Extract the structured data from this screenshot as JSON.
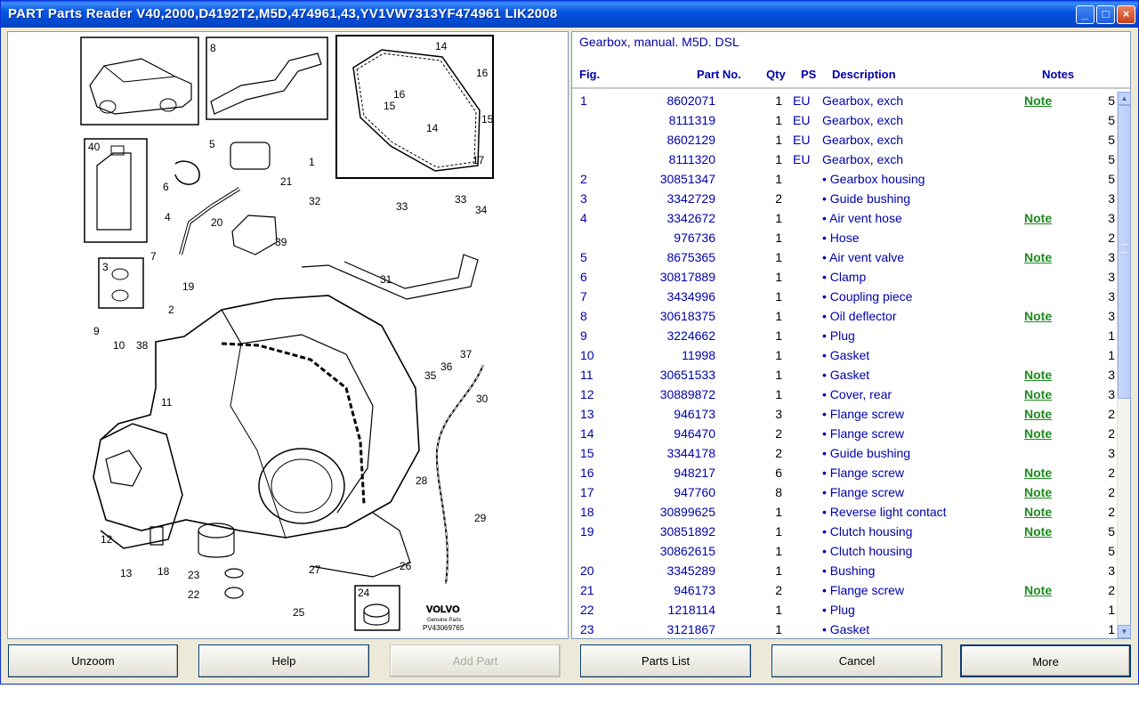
{
  "window": {
    "title": "PART Parts Reader V40,2000,D4192T2,M5D,474961,43,YV1VW7313YF474961 LIK2008",
    "min_glyph": "_",
    "max_glyph": "□",
    "close_glyph": "×"
  },
  "diagram": {
    "brand": "VOLVO",
    "brand_sub": "Genuine Parts",
    "ref": "PV43069765"
  },
  "group_title": "Gearbox, manual. M5D. DSL",
  "columns": {
    "fig": "Fig.",
    "part": "Part No.",
    "qty": "Qty",
    "ps": "PS",
    "desc": "Description",
    "notes": "Notes"
  },
  "rows": [
    {
      "fig": "1",
      "part": "8602071",
      "qty": "1",
      "ps": "EU",
      "desc": "Gearbox, exch",
      "note": "Note",
      "n": "5"
    },
    {
      "fig": "",
      "part": "8111319",
      "qty": "1",
      "ps": "EU",
      "desc": "Gearbox, exch",
      "note": "",
      "n": "5"
    },
    {
      "fig": "",
      "part": "8602129",
      "qty": "1",
      "ps": "EU",
      "desc": "Gearbox, exch",
      "note": "",
      "n": "5"
    },
    {
      "fig": "",
      "part": "8111320",
      "qty": "1",
      "ps": "EU",
      "desc": "Gearbox, exch",
      "note": "",
      "n": "5"
    },
    {
      "fig": "2",
      "part": "30851347",
      "qty": "1",
      "ps": "",
      "desc": "• Gearbox housing",
      "note": "",
      "n": "5"
    },
    {
      "fig": "3",
      "part": "3342729",
      "qty": "2",
      "ps": "",
      "desc": "• Guide bushing",
      "note": "",
      "n": "3"
    },
    {
      "fig": "4",
      "part": "3342672",
      "qty": "1",
      "ps": "",
      "desc": "• Air vent hose",
      "note": "Note",
      "n": "3"
    },
    {
      "fig": "",
      "part": "976736",
      "qty": "1",
      "ps": "",
      "desc": "• Hose",
      "note": "",
      "n": "2"
    },
    {
      "fig": "5",
      "part": "8675365",
      "qty": "1",
      "ps": "",
      "desc": "• Air vent valve",
      "note": "Note",
      "n": "3"
    },
    {
      "fig": "6",
      "part": "30817889",
      "qty": "1",
      "ps": "",
      "desc": "• Clamp",
      "note": "",
      "n": "3"
    },
    {
      "fig": "7",
      "part": "3434996",
      "qty": "1",
      "ps": "",
      "desc": "• Coupling piece",
      "note": "",
      "n": "3"
    },
    {
      "fig": "8",
      "part": "30618375",
      "qty": "1",
      "ps": "",
      "desc": "• Oil deflector",
      "note": "Note",
      "n": "3"
    },
    {
      "fig": "9",
      "part": "3224662",
      "qty": "1",
      "ps": "",
      "desc": "• Plug",
      "note": "",
      "n": "1"
    },
    {
      "fig": "10",
      "part": "11998",
      "qty": "1",
      "ps": "",
      "desc": "• Gasket",
      "note": "",
      "n": "1"
    },
    {
      "fig": "11",
      "part": "30651533",
      "qty": "1",
      "ps": "",
      "desc": "• Gasket",
      "note": "Note",
      "n": "3"
    },
    {
      "fig": "12",
      "part": "30889872",
      "qty": "1",
      "ps": "",
      "desc": "• Cover, rear",
      "note": "Note",
      "n": "3"
    },
    {
      "fig": "13",
      "part": "946173",
      "qty": "3",
      "ps": "",
      "desc": "• Flange screw",
      "note": "Note",
      "n": "2"
    },
    {
      "fig": "14",
      "part": "946470",
      "qty": "2",
      "ps": "",
      "desc": "• Flange screw",
      "note": "Note",
      "n": "2"
    },
    {
      "fig": "15",
      "part": "3344178",
      "qty": "2",
      "ps": "",
      "desc": "• Guide bushing",
      "note": "",
      "n": "3"
    },
    {
      "fig": "16",
      "part": "948217",
      "qty": "6",
      "ps": "",
      "desc": "• Flange screw",
      "note": "Note",
      "n": "2"
    },
    {
      "fig": "17",
      "part": "947760",
      "qty": "8",
      "ps": "",
      "desc": "• Flange screw",
      "note": "Note",
      "n": "2"
    },
    {
      "fig": "18",
      "part": "30899625",
      "qty": "1",
      "ps": "",
      "desc": "• Reverse light contact",
      "note": "Note",
      "n": "2"
    },
    {
      "fig": "19",
      "part": "30851892",
      "qty": "1",
      "ps": "",
      "desc": "• Clutch housing",
      "note": "Note",
      "n": "5"
    },
    {
      "fig": "",
      "part": "30862615",
      "qty": "1",
      "ps": "",
      "desc": "• Clutch housing",
      "note": "",
      "n": "5"
    },
    {
      "fig": "20",
      "part": "3345289",
      "qty": "1",
      "ps": "",
      "desc": "• Bushing",
      "note": "",
      "n": "3"
    },
    {
      "fig": "21",
      "part": "946173",
      "qty": "2",
      "ps": "",
      "desc": "• Flange screw",
      "note": "Note",
      "n": "2"
    },
    {
      "fig": "22",
      "part": "1218114",
      "qty": "1",
      "ps": "",
      "desc": "• Plug",
      "note": "",
      "n": "1"
    },
    {
      "fig": "23",
      "part": "3121867",
      "qty": "1",
      "ps": "",
      "desc": "• Gasket",
      "note": "",
      "n": "1"
    }
  ],
  "buttons": {
    "unzoom": "Unzoom",
    "help": "Help",
    "add_part": "Add Part",
    "parts_list": "Parts List",
    "cancel": "Cancel",
    "more": "More"
  },
  "colors": {
    "title_bar": "#0655e3",
    "list_text": "#0000a8",
    "note_link": "#1d8a1d"
  }
}
